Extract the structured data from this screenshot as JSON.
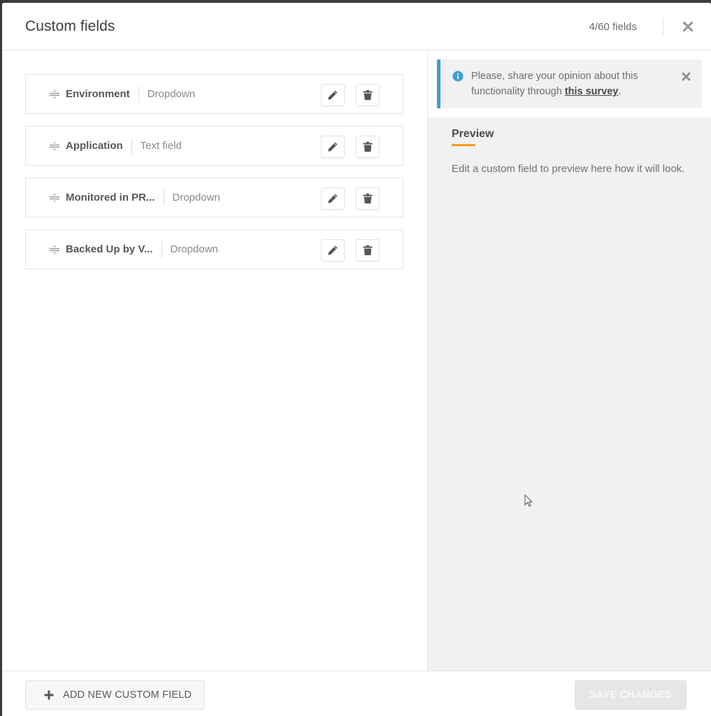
{
  "header": {
    "title": "Custom fields",
    "field_count": "4/60 fields",
    "close_icon": "close-icon"
  },
  "fields": [
    {
      "name": "Environment",
      "type": "Dropdown"
    },
    {
      "name": "Application",
      "type": "Text field"
    },
    {
      "name": "Monitored in PR...",
      "type": "Dropdown"
    },
    {
      "name": "Backed Up by V...",
      "type": "Dropdown"
    }
  ],
  "row_icons": {
    "drag": "drag-handle-icon",
    "edit": "pencil-icon",
    "delete": "trash-icon"
  },
  "notice": {
    "text_before": "Please, share your opinion about this functionality through ",
    "link_text": "this survey",
    "text_after": ".",
    "icon": "info-icon",
    "accent_color": "#3c9fd3"
  },
  "preview": {
    "title": "Preview",
    "text": "Edit a custom field to preview here how it will look.",
    "accent_color": "#f29c1f"
  },
  "footer": {
    "add_label": "ADD NEW CUSTOM FIELD",
    "save_label": "SAVE CHANGES",
    "save_disabled": true
  }
}
